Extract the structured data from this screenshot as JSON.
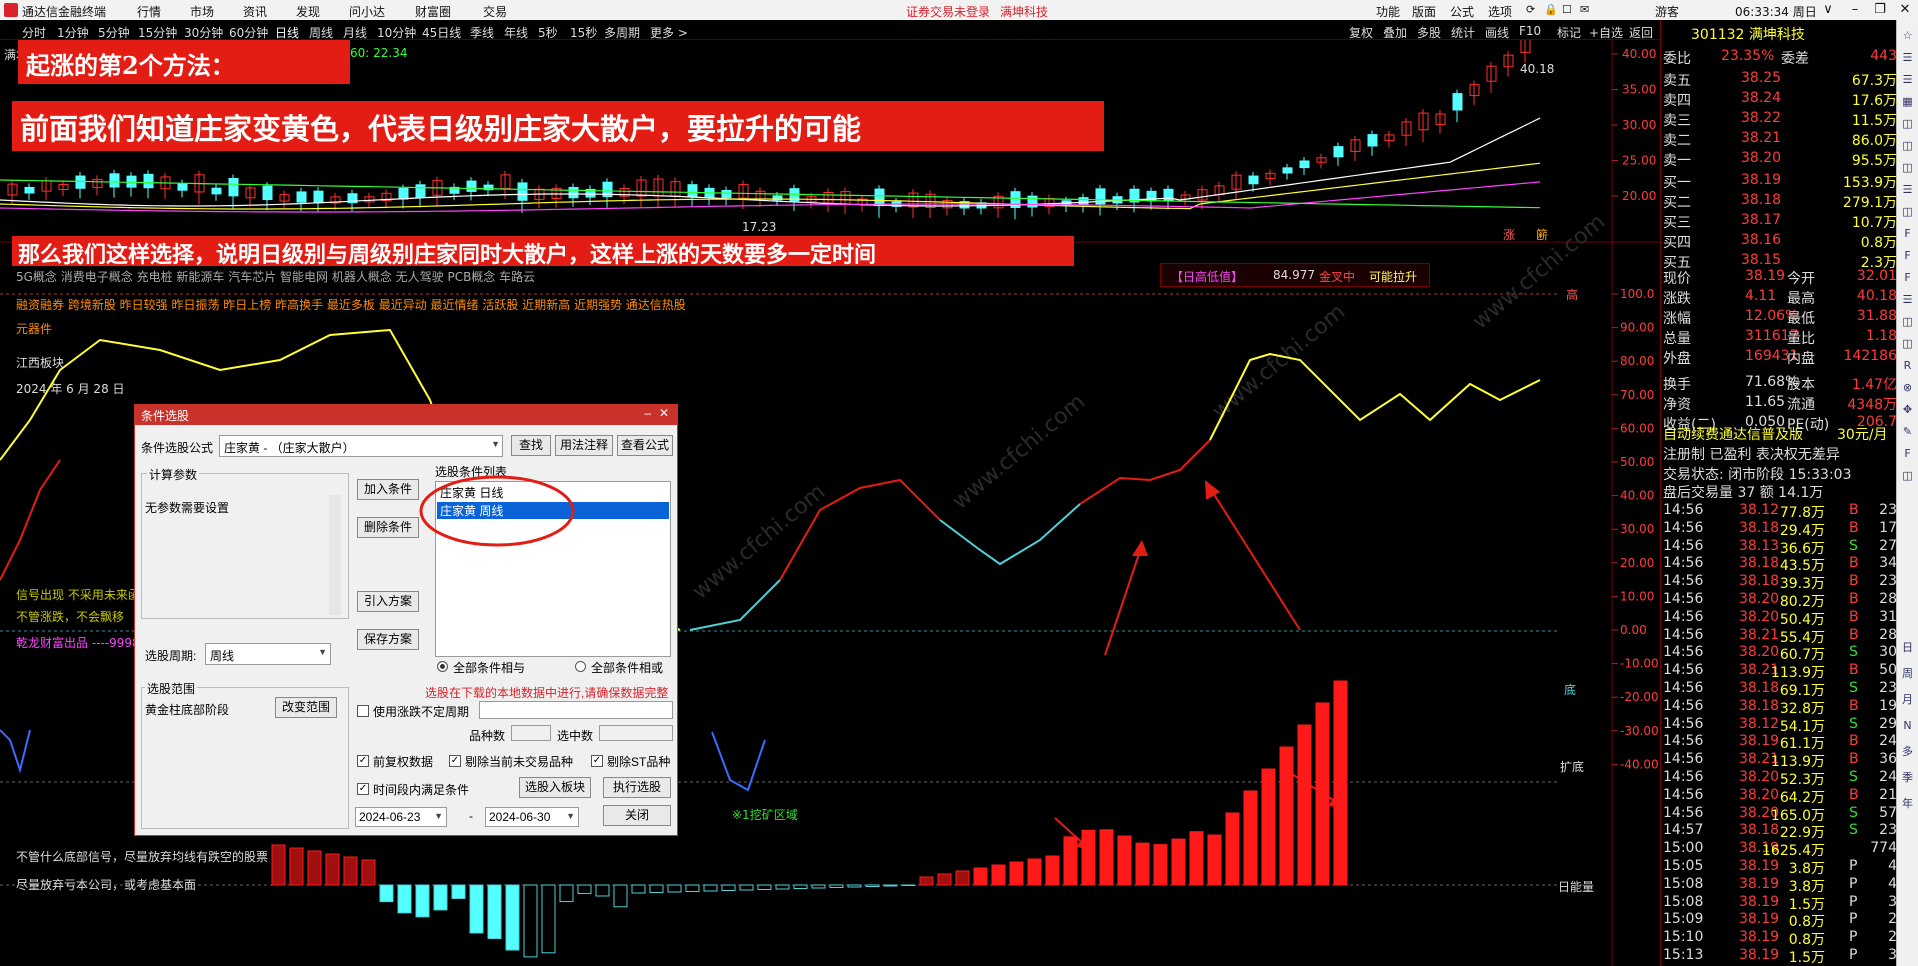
{
  "menubar": {
    "app_title": "通达信金融终端",
    "items": [
      "行情",
      "市场",
      "资讯",
      "发现",
      "问小达",
      "财富圈",
      "交易"
    ],
    "warning": "证券交易未登录",
    "stock_label": "满坤科技",
    "right_items": [
      "功能",
      "版面",
      "公式",
      "选项"
    ],
    "user": "游客",
    "time": "06:33:34 周日"
  },
  "periods": [
    "分时",
    "1分钟",
    "5分钟",
    "15分钟",
    "30分钟",
    "60分钟",
    "日线",
    "周线",
    "月线",
    "10分钟",
    "45日线",
    "季线",
    "年线",
    "5秒",
    "15秒",
    "多周期",
    "更多 >"
  ],
  "period_active": "日线",
  "tools": [
    "复权",
    "叠加",
    "多股",
    "统计",
    "画线",
    "F10",
    "标记",
    "+自选",
    "返回"
  ],
  "banners": {
    "b1": "起涨的第2个方法：",
    "b2": "前面我们知道庄家变黄色，代表日级别庄家大散户，要拉升的可能",
    "b3": "那么我们这样选择，说明日级别与周级别庄家同时大散户，这样上涨的天数要多一定时间"
  },
  "chart_text": {
    "ma60": "4  MA60: 22.34",
    "stock_short": "满坤",
    "concepts": "5G概念 消费电子概念 充电桩 新能源车 汽车芯片 智能电网 机器人概念 无人驾驶 PCB概念 车路云",
    "tags": "融资融券 跨境新股 昨日较强 昨日振荡 昨日上榜 昨高换手 最近多板 最近异动 最近情绪 活跃股 近期新高 近期强势 通达信热股",
    "industry": "元器件",
    "region": "江西板块",
    "date": "2024 年 6 月 28 日",
    "signal1": "信号出现  不采用未来函数",
    "signal2": "不管涨跌，不会飘移",
    "qianlong": "乾龙财富出品 ----9998",
    "foot1": "不管什么底部信号，尽量放弃均线有跌空的股票",
    "foot2": "尽量放弃亏本公司，或考虑基本面",
    "mine": "※1挖矿区域",
    "ind_box_left": "【日高低值】",
    "ind_box_val": "84.977",
    "ind_box_mid": "金叉中",
    "ind_box_right": "可能拉升",
    "hi_price": "40.18",
    "lo_price": "17.23",
    "mark_gao": "高",
    "mark_di": "底",
    "mark_kuodi": "扩底",
    "mark_rinengliang": "日能量",
    "mark_zhang": "涨",
    "mark_xiao": "簖",
    "watermark": "www.cfchi.com"
  },
  "price_axis": [
    "40.00",
    "35.00",
    "30.00",
    "25.00",
    "20.00"
  ],
  "ind_axis": [
    "100.0",
    "90.00",
    "80.00",
    "70.00",
    "60.00",
    "50.00",
    "40.00",
    "30.00",
    "20.00",
    "10.00",
    "0.00",
    "-10.00",
    "-20.00",
    "-30.00",
    "-40.00"
  ],
  "dialog": {
    "title": "条件选股",
    "formula_label": "条件选股公式",
    "formula_value": "庄家黄 - （庄家大散户）",
    "btn_find": "查找",
    "btn_usage": "用法注释",
    "btn_view": "查看公式",
    "params_title": "计算参数",
    "params_text": "无参数需要设置",
    "btn_add": "加入条件",
    "btn_del": "删除条件",
    "btn_import": "引入方案",
    "btn_save": "保存方案",
    "cond_list_title": "选股条件列表",
    "conditions": [
      "庄家黄  日线",
      "庄家黄  周线"
    ],
    "period_label": "选股周期:",
    "period_value": "周线",
    "radio_and": "全部条件相与",
    "radio_or": "全部条件相或",
    "range_title": "选股范围",
    "range_text": "黄金柱底部阶段",
    "btn_range": "改变范围",
    "warn_text": "选股在下载的本地数据中进行,请确保数据完整",
    "chk_uncertain": "使用涨跌不定周期",
    "count_label": "品种数",
    "selected_label": "选中数",
    "chk_fq": "前复权数据",
    "chk_no_trade": "剔除当前未交易品种",
    "chk_st": "剔除ST品种",
    "chk_period": "时间段内满足条件",
    "btn_to_block": "选股入板块",
    "btn_run": "执行选股",
    "date_from": "2024-06-23",
    "date_sep": "-",
    "date_to": "2024-06-30",
    "btn_close": "关闭"
  },
  "quote": {
    "code_name": "301132 满坤科技",
    "weibi_label": "委比",
    "weibi": "23.35%",
    "weicha_label": "委差",
    "weicha": "443",
    "sells": [
      {
        "l": "卖五",
        "p": "38.25",
        "v": "67.3万"
      },
      {
        "l": "卖四",
        "p": "38.24",
        "v": "17.6万"
      },
      {
        "l": "卖三",
        "p": "38.22",
        "v": "11.5万"
      },
      {
        "l": "卖二",
        "p": "38.21",
        "v": "86.0万"
      },
      {
        "l": "卖一",
        "p": "38.20",
        "v": "95.5万"
      }
    ],
    "buys": [
      {
        "l": "买一",
        "p": "38.19",
        "v": "153.9万"
      },
      {
        "l": "买二",
        "p": "38.18",
        "v": "279.1万"
      },
      {
        "l": "买三",
        "p": "38.17",
        "v": "10.7万"
      },
      {
        "l": "买四",
        "p": "38.16",
        "v": "0.8万"
      },
      {
        "l": "买五",
        "p": "38.15",
        "v": "2.3万"
      }
    ],
    "stats": [
      [
        "现价",
        "38.19",
        "今开",
        "32.01"
      ],
      [
        "涨跌",
        "4.11",
        "最高",
        "40.18"
      ],
      [
        "涨幅",
        "12.06%",
        "最低",
        "31.88"
      ],
      [
        "总量",
        "311617",
        "量比",
        "1.18"
      ],
      [
        "外盘",
        "169431",
        "内盘",
        "142186"
      ],
      [
        "换手",
        "71.68%",
        "股本",
        "1.47亿"
      ],
      [
        "净资",
        "11.65",
        "流通",
        "4348万"
      ],
      [
        "收益(二)",
        "0.050",
        "PE(动)",
        "206.7"
      ]
    ],
    "ad": "自动续费通达信普及版",
    "ad_price": "30元/月",
    "reg": "注册制 已盈利 表决权无差异",
    "trade_state": "交易状态: 闭市阶段 15:33:03",
    "after": "盘后交易量 37 额 14.1万",
    "ticks": [
      [
        "14:56",
        "38.12",
        "77.8万",
        "B",
        "23"
      ],
      [
        "14:56",
        "38.18",
        "29.4万",
        "B",
        "17"
      ],
      [
        "14:56",
        "38.13",
        "36.6万",
        "S",
        "27"
      ],
      [
        "14:56",
        "38.18",
        "43.5万",
        "B",
        "34"
      ],
      [
        "14:56",
        "38.18",
        "39.3万",
        "B",
        "23"
      ],
      [
        "14:56",
        "38.20",
        "80.2万",
        "B",
        "28"
      ],
      [
        "14:56",
        "38.20",
        "50.4万",
        "B",
        "31"
      ],
      [
        "14:56",
        "38.21",
        "55.4万",
        "B",
        "28"
      ],
      [
        "14:56",
        "38.20",
        "60.7万",
        "S",
        "30"
      ],
      [
        "14:56",
        "38.21",
        "113.9万",
        "B",
        "50"
      ],
      [
        "14:56",
        "38.18",
        "69.1万",
        "S",
        "23"
      ],
      [
        "14:56",
        "38.18",
        "32.8万",
        "B",
        "19"
      ],
      [
        "14:56",
        "38.12",
        "54.1万",
        "S",
        "29"
      ],
      [
        "14:56",
        "38.19",
        "61.1万",
        "B",
        "24"
      ],
      [
        "14:56",
        "38.21",
        "113.9万",
        "B",
        "36"
      ],
      [
        "14:56",
        "38.20",
        "52.3万",
        "S",
        "24"
      ],
      [
        "14:56",
        "38.20",
        "64.2万",
        "B",
        "21"
      ],
      [
        "14:56",
        "38.20",
        "165.0万",
        "S",
        "57"
      ],
      [
        "14:57",
        "38.18",
        "22.9万",
        "S",
        "23"
      ],
      [
        "15:00",
        "38.19",
        "1625.4万",
        "",
        "774"
      ],
      [
        "15:05",
        "38.19",
        "3.8万",
        "P",
        "4"
      ],
      [
        "15:08",
        "38.19",
        "3.8万",
        "P",
        "4"
      ],
      [
        "15:08",
        "38.19",
        "1.5万",
        "P",
        "3"
      ],
      [
        "15:09",
        "38.19",
        "0.8万",
        "P",
        "2"
      ],
      [
        "15:10",
        "38.19",
        "0.8万",
        "P",
        "2"
      ],
      [
        "15:13",
        "38.19",
        "1.5万",
        "P",
        "3"
      ]
    ]
  },
  "side_icons": [
    "日",
    "周",
    "月",
    "N",
    "多",
    "季",
    "年"
  ],
  "colors": {
    "red": "#e31d14",
    "up": "#ff2a2a",
    "down": "#54ffff",
    "yellow": "#ffff33",
    "green": "#00c000",
    "magenta": "#ff00ff",
    "cyan": "#4fd1d9"
  }
}
